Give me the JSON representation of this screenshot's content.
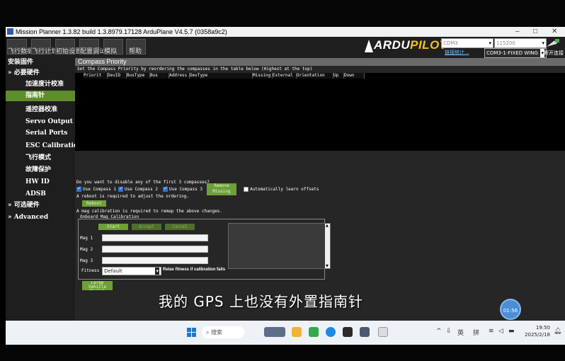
{
  "window": {
    "title": "Mission Planner 1.3.82 build 1.3.8979.17128 ArduPlane V4.5.7 (0358a9c2)",
    "controls": [
      "–",
      "□",
      "✕"
    ]
  },
  "menubar": {
    "items": [
      {
        "label": "飞行数据",
        "icon": "airplane-icon"
      },
      {
        "label": "飞行计划",
        "icon": "map-icon"
      },
      {
        "label": "初始设置",
        "icon": "setup-icon"
      },
      {
        "label": "配置调试",
        "icon": "config-icon"
      },
      {
        "label": "模拟",
        "icon": "simulation-icon"
      },
      {
        "label": "帮助",
        "icon": "help-icon"
      }
    ],
    "logo": {
      "ardu": "ARDU",
      "pilot": "PILOT"
    },
    "port_value": "COM3",
    "baud_value": "115200",
    "stats_link": "链接统计...",
    "profile_value": "COM3-1-FIXED WING",
    "connect_label": "断开连接"
  },
  "leftnav": {
    "items": [
      {
        "label": "安装固件",
        "kind": "top"
      },
      {
        "label": "» 必要硬件",
        "kind": "top"
      },
      {
        "label": "加速度计校准",
        "kind": "sub"
      },
      {
        "label": "指南针",
        "kind": "sub",
        "active": true
      },
      {
        "label": "遥控器校准",
        "kind": "sub"
      },
      {
        "label": "Servo Output",
        "kind": "sub"
      },
      {
        "label": "Serial Ports",
        "kind": "sub"
      },
      {
        "label": "ESC Calibration",
        "kind": "sub"
      },
      {
        "label": "飞行模式",
        "kind": "sub"
      },
      {
        "label": "故障保护",
        "kind": "sub"
      },
      {
        "label": "HW ID",
        "kind": "sub"
      },
      {
        "label": "ADSB",
        "kind": "sub"
      },
      {
        "label": "» 可选硬件",
        "kind": "top"
      },
      {
        "label": "» Advanced",
        "kind": "top"
      }
    ]
  },
  "content": {
    "header": "Compass Priority",
    "priority_hint": "Set the Compass Priority by reordering the compasses in the table below (Highest at the top)",
    "grid_columns": [
      "Priorit",
      "DevID",
      "BusType",
      "Bus",
      "Address",
      "DevType",
      "Missing",
      "External",
      "Orientation",
      "Up",
      "Down"
    ],
    "disable_question": "Do you want to disable any of the first 3 compasses?",
    "compasses": [
      {
        "label": "Use Compass 1",
        "checked": true
      },
      {
        "label": "Use Compass 2",
        "checked": true
      },
      {
        "label": "Use Compass 3",
        "checked": true
      }
    ],
    "remove_missing_label": "Remove Missing",
    "auto_learn_label": "Automatically learn offsets",
    "reboot_note": "A reboot is required to adjust the ordering.",
    "reboot_label": "Reboot",
    "mag_cal_note": "A mag calibration is required to remap the above changes.",
    "onboard_group": "Onboard Mag Calibration",
    "start_label": "Start",
    "accept_label": "Accept",
    "cancel_label": "Cancel",
    "mag_labels": [
      "Mag 1",
      "Mag 2",
      "Mag 3"
    ],
    "fitness_label": "Fitness",
    "fitness_value": "Default",
    "relax_label": "Relax fitness if calibration fails",
    "large_vehicle_label": "Large Vehicle MagCal"
  },
  "subtitle": "我的 GPS 上也没有外置指南针",
  "bubble_text": "01:56",
  "taskbar": {
    "search_label": "搜索",
    "lang1": "英",
    "lang2": "拼",
    "time": "19:50",
    "date": "2025/2/18"
  },
  "colors": {
    "accent_green": "#6e9f3a",
    "nav_active": "#5e8d2b",
    "logo_yellow": "#f3c316"
  }
}
